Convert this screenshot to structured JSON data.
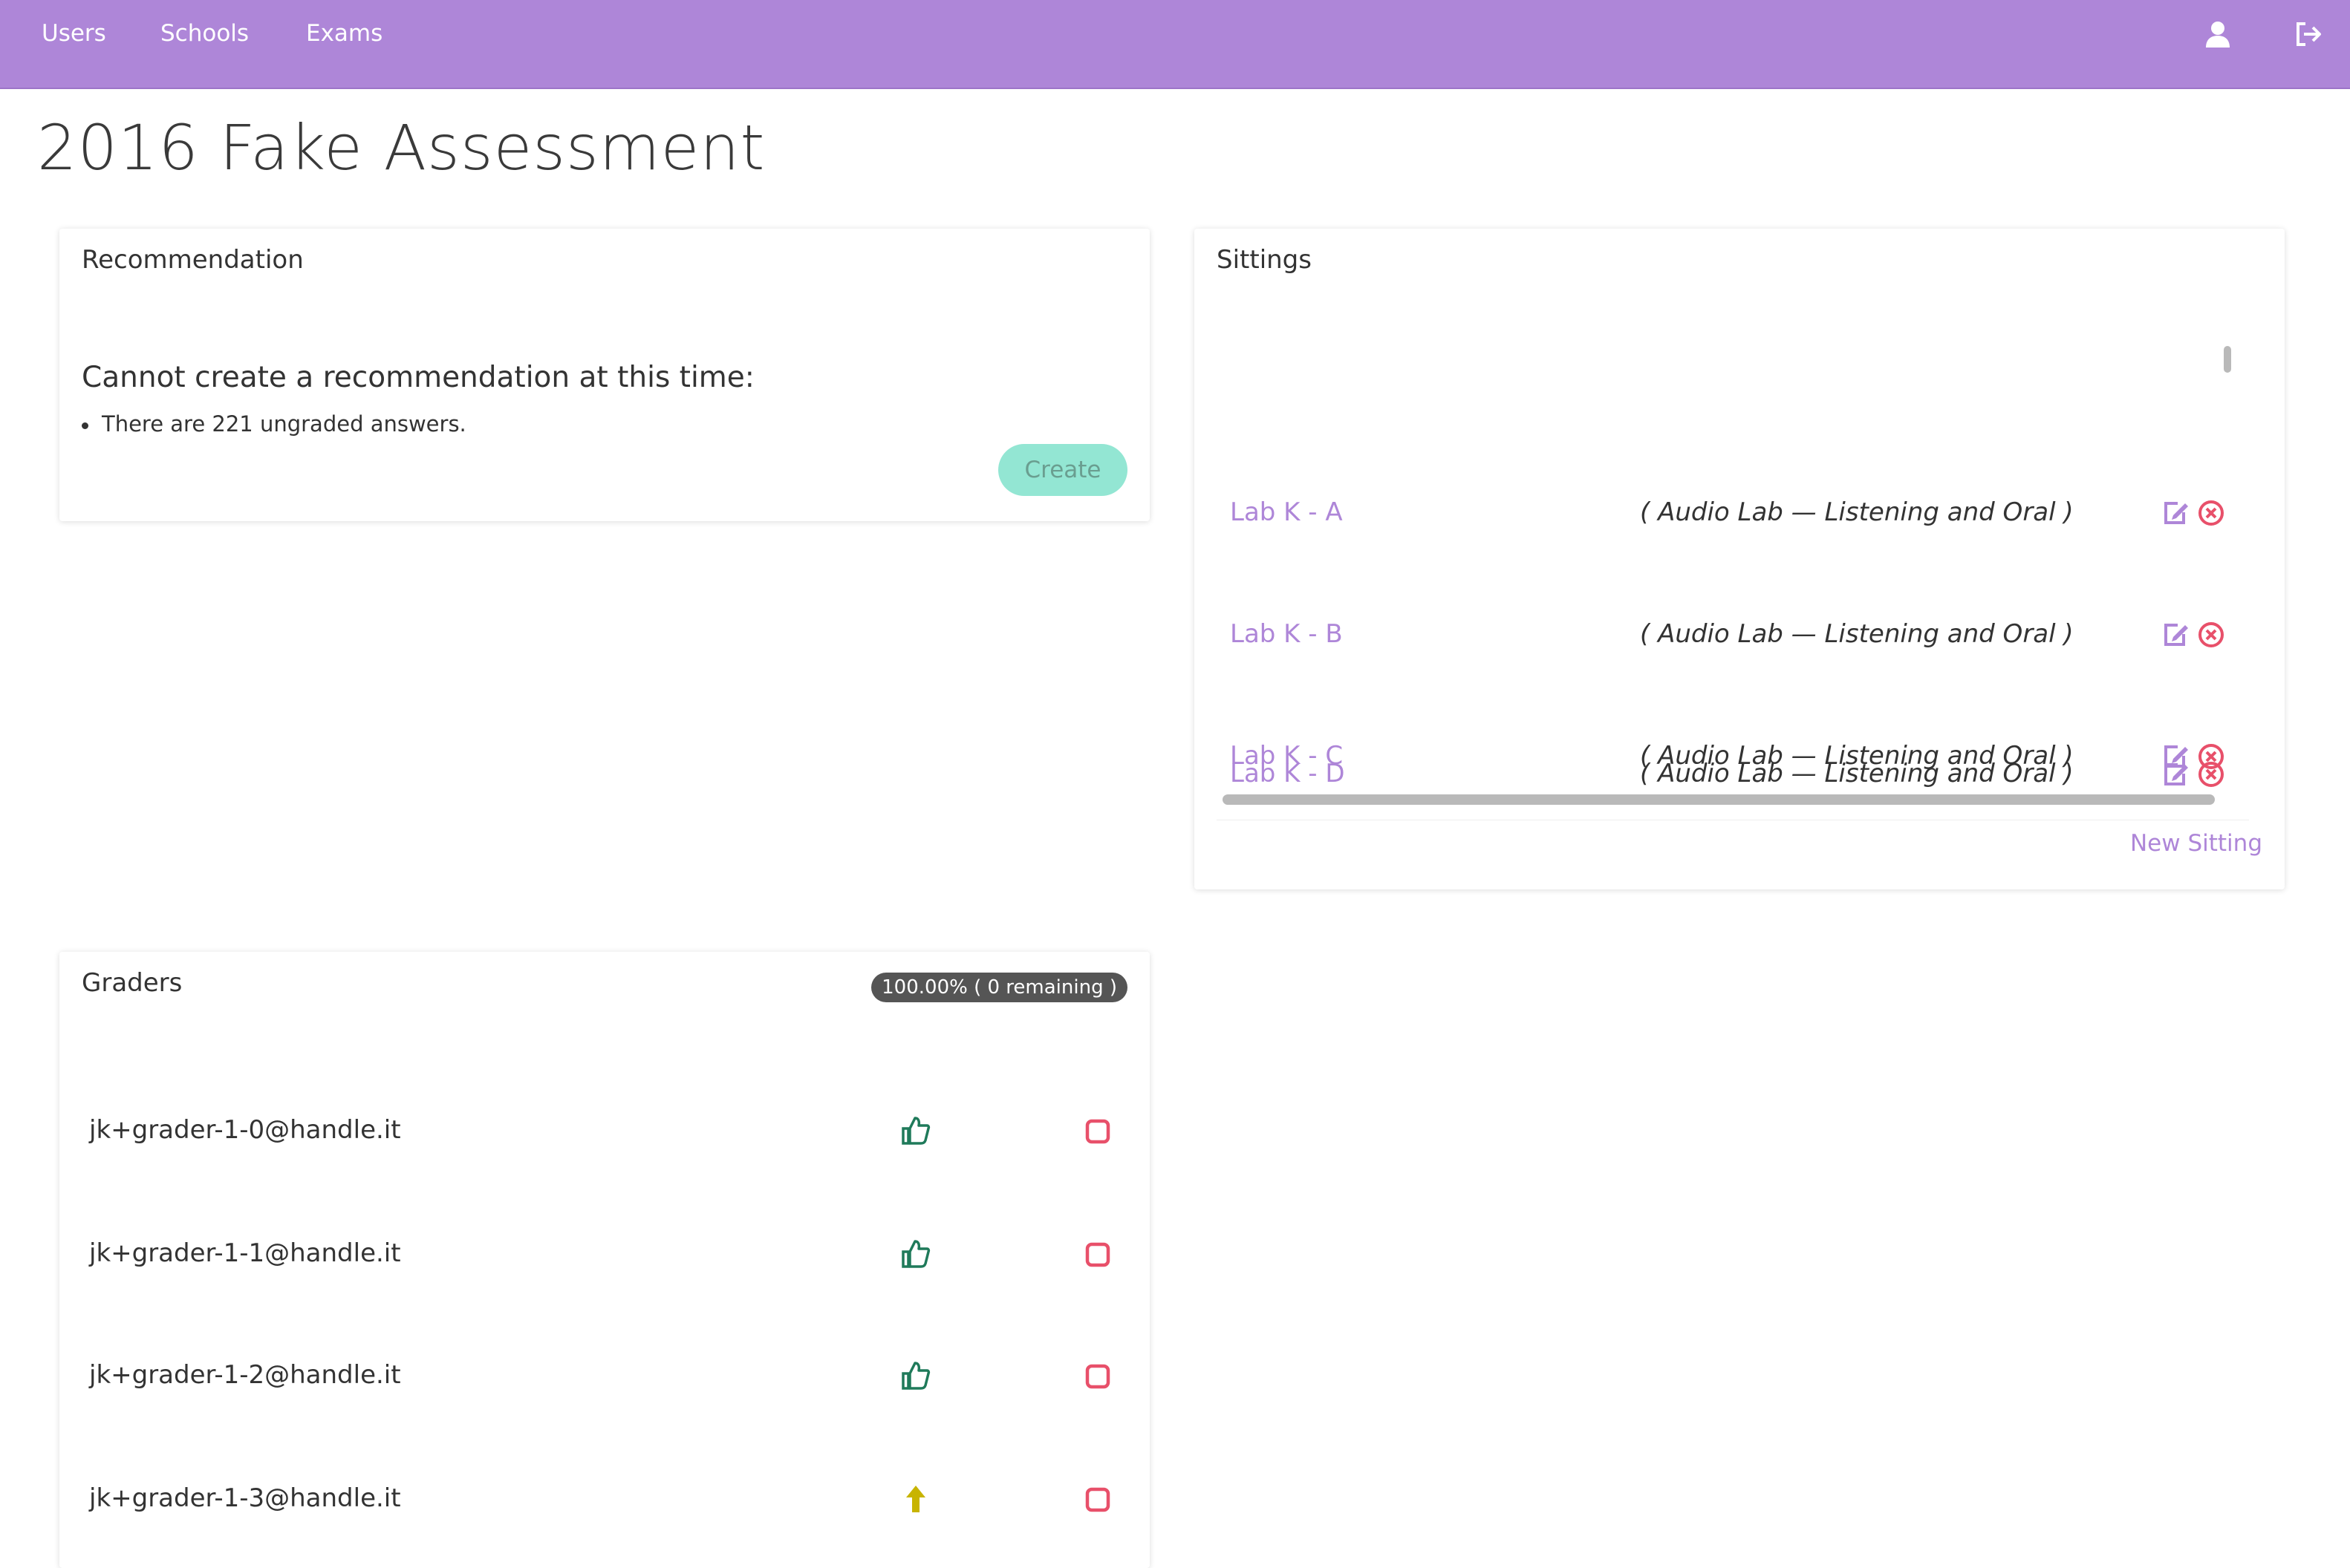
{
  "nav": {
    "links": [
      "Users",
      "Schools",
      "Exams"
    ],
    "icons": [
      "user-icon",
      "logout-icon"
    ]
  },
  "page": {
    "title": "2016 Fake Assessment"
  },
  "recommendation": {
    "title": "Recommendation",
    "heading": "Cannot create a recommendation at this time:",
    "reasons": [
      "There are 221 ungraded answers."
    ],
    "create_label": "Create"
  },
  "sittings": {
    "title": "Sittings",
    "items": [
      {
        "name": "Lab K - A",
        "description": "( Audio Lab — Listening and Oral )"
      },
      {
        "name": "Lab K - B",
        "description": "( Audio Lab — Listening and Oral )"
      },
      {
        "name": "Lab K - C",
        "description": "( Audio Lab — Listening and Oral )"
      },
      {
        "name": "Lab K - D",
        "description": "( Audio Lab — Listening and Oral )"
      }
    ],
    "new_label": "New Sitting"
  },
  "graders": {
    "title": "Graders",
    "progress": "100.00% ( 0 remaining )",
    "items": [
      {
        "email": "jk+grader-1-0@handle.it",
        "status": "thumbs-up-icon"
      },
      {
        "email": "jk+grader-1-1@handle.it",
        "status": "thumbs-up-icon"
      },
      {
        "email": "jk+grader-1-2@handle.it",
        "status": "thumbs-up-icon"
      },
      {
        "email": "jk+grader-1-3@handle.it",
        "status": "arrow-up-icon"
      }
    ]
  },
  "colors": {
    "brand": "#ae86d8",
    "success": "#1f7a5a",
    "warning": "#c8b400",
    "danger": "#e8506a",
    "button_disabled": "#93e6d3"
  }
}
